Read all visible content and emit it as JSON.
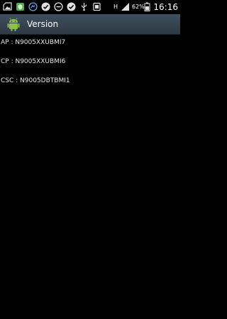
{
  "status_bar": {
    "network_type": "H",
    "battery_percent": "62%",
    "time": "16:16",
    "icons": [
      "gallery-icon",
      "security-shield-icon",
      "messenger-icon",
      "check-circle-icon",
      "do-not-disturb-icon",
      "download-check-icon",
      "usb-icon",
      "screenshot-icon",
      "vibrate-icon",
      "signal-icon",
      "battery-icon"
    ]
  },
  "action_bar": {
    "title": "Version",
    "icon": "android-icon",
    "accent_color": "#3a4956"
  },
  "versions": [
    {
      "label": "AP",
      "value": "N9005XXUBMI7",
      "text": "AP : N9005XXUBMI7"
    },
    {
      "label": "CP",
      "value": "N9005XXUBMI6",
      "text": "CP : N9005XXUBMI6"
    },
    {
      "label": "CSC",
      "value": "N9005DBTBMI1",
      "text": "CSC : N9005DBTBMI1"
    }
  ]
}
